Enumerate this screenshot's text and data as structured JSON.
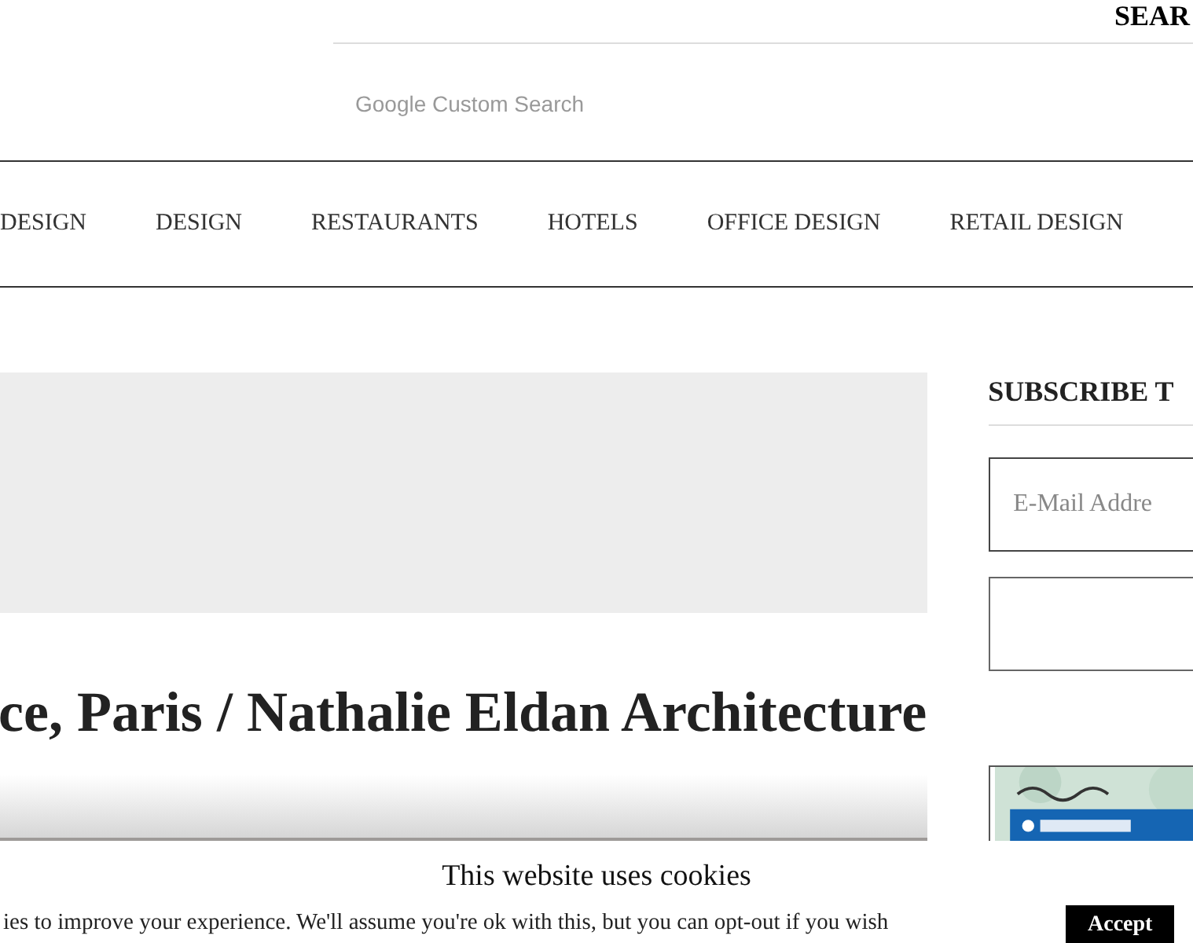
{
  "header": {
    "search_label": "SEAR",
    "search_field": {
      "placeholder": "Google Custom Search"
    }
  },
  "nav": {
    "items": [
      {
        "label": "DESIGN"
      },
      {
        "label": "DESIGN"
      },
      {
        "label": "RESTAURANTS"
      },
      {
        "label": "HOTELS"
      },
      {
        "label": "OFFICE DESIGN"
      },
      {
        "label": "RETAIL DESIGN"
      }
    ]
  },
  "article": {
    "title": "ce, Paris / Nathalie Eldan Architecture"
  },
  "sidebar": {
    "heading": "SUBSCRIBE T",
    "email_field": {
      "placeholder": "E-Mail Addre"
    }
  },
  "cookie_bar": {
    "title": "This website uses cookies",
    "text": "ies to improve your experience. We'll assume you're ok with this, but you can opt-out if you wish",
    "accept": "Accept"
  }
}
